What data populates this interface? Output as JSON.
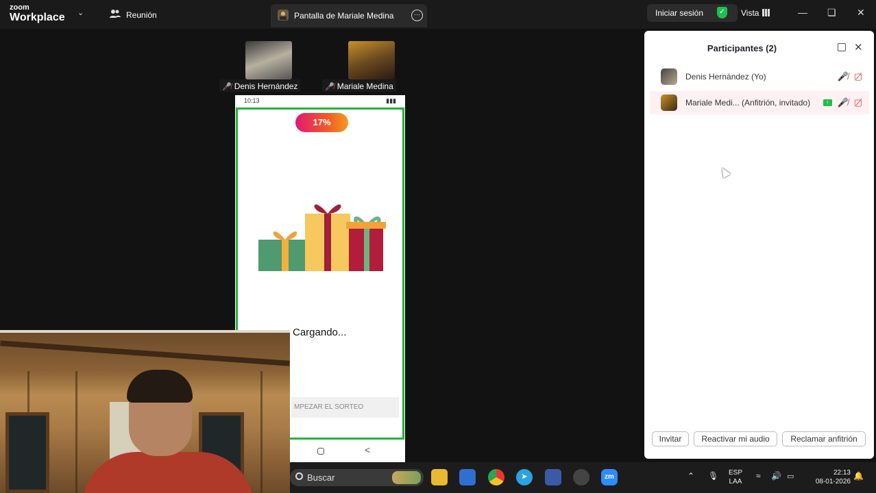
{
  "topbar": {
    "logo_small": "zoom",
    "logo_big": "Workplace",
    "meeting_label": "Reunión",
    "share_tab_label": "Pantalla de Mariale Medina",
    "signin_label": "Iniciar sesión",
    "view_label": "Vista"
  },
  "thumbnails": [
    {
      "name": "Denis Hernández"
    },
    {
      "name": "Mariale Medina"
    }
  ],
  "phone": {
    "status_time": "10:13",
    "progress_label": "17%",
    "progress_value": 0.17,
    "loading_text": "Cargando...",
    "start_button": "MPEZAR EL SORTEO"
  },
  "panel": {
    "title": "Participantes (2)",
    "participants": [
      {
        "name": "Denis Hernández (Yo)",
        "sharing": false
      },
      {
        "name": "Mariale Medi... (Anfitrión, invitado)",
        "sharing": true
      }
    ],
    "buttons": {
      "invite": "Invitar",
      "unmute": "Reactivar mi audio",
      "claim_host": "Reclamar anfitrión"
    }
  },
  "taskbar": {
    "search_placeholder": "Buscar",
    "lang_line1": "ESP",
    "lang_line2": "LAA",
    "time": "22:13",
    "date": "08-01-2026"
  },
  "colors": {
    "accent_green": "#22b33d",
    "muted_red": "#e54040",
    "zoom_blue": "#2d8cff"
  }
}
